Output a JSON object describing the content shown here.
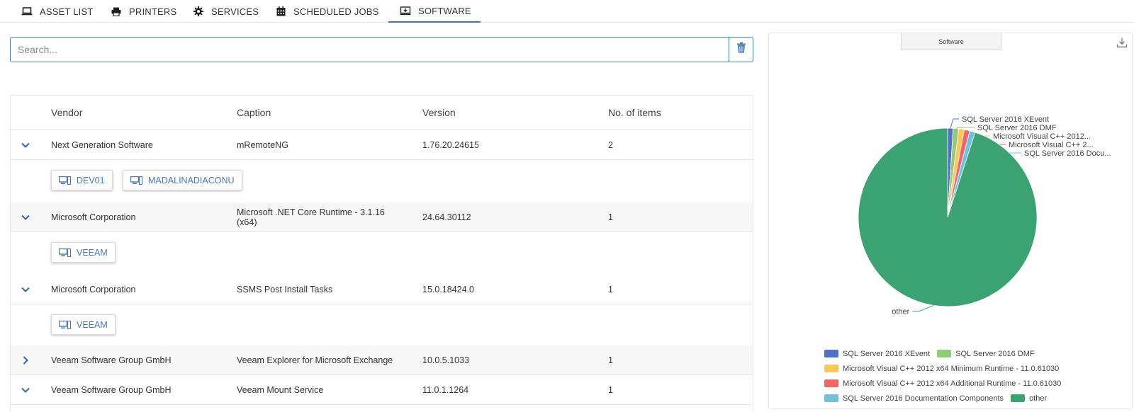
{
  "tabs": [
    {
      "label": "ASSET LIST",
      "icon": "laptop-icon"
    },
    {
      "label": "PRINTERS",
      "icon": "printer-icon"
    },
    {
      "label": "SERVICES",
      "icon": "gear-icon"
    },
    {
      "label": "SCHEDULED JOBS",
      "icon": "calendar-icon"
    },
    {
      "label": "SOFTWARE",
      "icon": "software-install-icon",
      "active": true
    }
  ],
  "search": {
    "placeholder": "Search...",
    "value": "",
    "clear_icon": "trash-icon"
  },
  "table": {
    "headers": {
      "vendor": "Vendor",
      "caption": "Caption",
      "version": "Version",
      "items": "No. of items"
    },
    "rows": [
      {
        "vendor": "Next Generation Software",
        "caption": "mRemoteNG",
        "version": "1.76.20.24615",
        "items": "2",
        "expanded": true,
        "devices": [
          "DEV01",
          "MADALINADIACONU"
        ]
      },
      {
        "vendor": "Microsoft Corporation",
        "caption": "Microsoft .NET Core Runtime - 3.1.16 (x64)",
        "version": "24.64.30112",
        "items": "1",
        "expanded": true,
        "devices": [
          "VEEAM"
        ]
      },
      {
        "vendor": "Microsoft Corporation",
        "caption": "SSMS Post Install Tasks",
        "version": "15.0.18424.0",
        "items": "1",
        "expanded": true,
        "devices": [
          "VEEAM"
        ]
      },
      {
        "vendor": "Veeam Software Group GmbH",
        "caption": "Veeam Explorer for Microsoft Exchange",
        "version": "10.0.5.1033",
        "items": "1",
        "expanded": false,
        "devices": []
      },
      {
        "vendor": "Veeam Software Group GmbH",
        "caption": "Veeam Mount Service",
        "version": "11.0.1.1264",
        "items": "1",
        "expanded": true,
        "devices": []
      }
    ]
  },
  "chart_panel": {
    "title_button": "Software",
    "download_icon": "download-icon"
  },
  "chart_data": {
    "type": "pie",
    "slices": [
      {
        "label": "SQL Server 2016 XEvent",
        "short_label": "SQL Server 2016 XEvent",
        "value": 1,
        "color": "#5470c6"
      },
      {
        "label": "SQL Server 2016 DMF",
        "short_label": "SQL Server 2016 DMF",
        "value": 1,
        "color": "#91cc75"
      },
      {
        "label": "Microsoft Visual C++ 2012 x64 Minimum Runtime - 11.0.61030",
        "short_label": "Microsoft Visual C++ 2012...",
        "value": 1,
        "color": "#fac858"
      },
      {
        "label": "Microsoft Visual C++ 2012 x64 Additional Runtime - 11.0.61030",
        "short_label": "Microsoft Visual C++ 2...",
        "value": 1,
        "color": "#ee6666"
      },
      {
        "label": "SQL Server 2016 Documentation Components",
        "short_label": "SQL Server 2016 Docu...",
        "value": 1,
        "color": "#73c0de"
      },
      {
        "label": "other",
        "short_label": "other",
        "value": 95,
        "color": "#3ba272"
      }
    ],
    "legend_placement": "bottom"
  }
}
